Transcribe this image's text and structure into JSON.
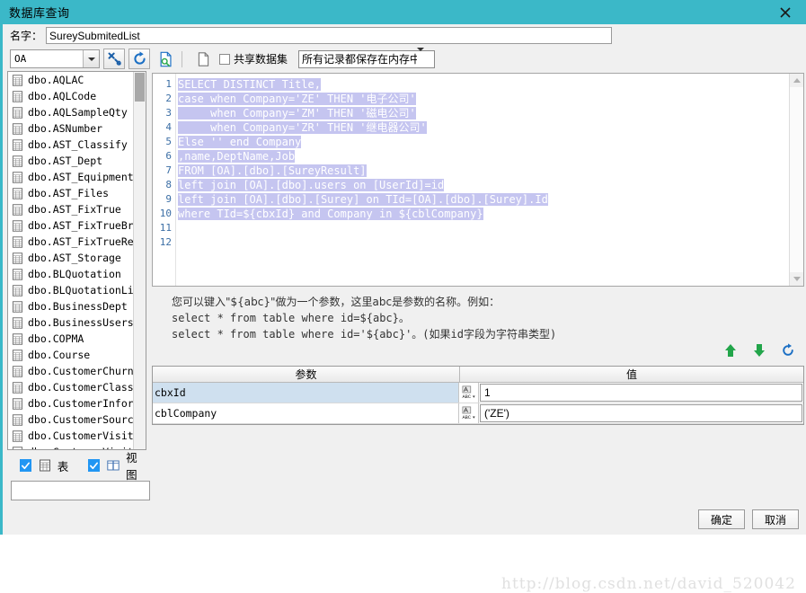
{
  "window": {
    "title": "数据库查询",
    "close_icon": "close-icon"
  },
  "name_row": {
    "label": "名字：",
    "value": "SureySubmitedList",
    "placeholder": ""
  },
  "toolbar": {
    "connection": "OA",
    "tools_icon": "wrench-tools-icon",
    "refresh_icon": "refresh-icon",
    "preview_icon": "preview-document-icon",
    "new_icon": "new-document-icon",
    "shared_dataset_label": "共享数据集",
    "shared_dataset_checked": false,
    "storage_mode": "所有记录都保存在内存中"
  },
  "sidebar": {
    "items": [
      "dbo.AQLAC",
      "dbo.AQLCode",
      "dbo.AQLSampleQty",
      "dbo.ASNumber",
      "dbo.AST_Classify",
      "dbo.AST_Dept",
      "dbo.AST_Equipment",
      "dbo.AST_Files",
      "dbo.AST_FixTrue",
      "dbo.AST_FixTrueBrorro",
      "dbo.AST_FixTrueReturn",
      "dbo.AST_Storage",
      "dbo.BLQuotation",
      "dbo.BLQuotationLine",
      "dbo.BusinessDept",
      "dbo.BusinessUsers",
      "dbo.COPMA",
      "dbo.Course",
      "dbo.CustomerChurn",
      "dbo.CustomerClass",
      "dbo.CustomerInformat",
      "dbo.CustomerSource",
      "dbo.CustomerVisitSug",
      "dbo.CustomerVisits"
    ],
    "table_checkbox": {
      "label": "表",
      "checked": true,
      "icon": "table-icon"
    },
    "view_checkbox": {
      "label": "视图",
      "checked": true,
      "icon": "view-icon"
    },
    "filter_value": "",
    "filter_placeholder": ""
  },
  "sql": {
    "lines": [
      {
        "no": "1",
        "text": "SELECT DISTINCT Title,"
      },
      {
        "no": "2",
        "text": "case when Company='ZE' THEN '电子公司'"
      },
      {
        "no": "3",
        "text": "     when Company='ZM' THEN '磁电公司'"
      },
      {
        "no": "4",
        "text": "     when Company='ZR' THEN '继电器公司'"
      },
      {
        "no": "5",
        "text": "Else '' end Company"
      },
      {
        "no": "6",
        "text": ",name,DeptName,Job"
      },
      {
        "no": "7",
        "text": "FROM [OA].[dbo].[SureyResult]"
      },
      {
        "no": "8",
        "text": "left join [OA].[dbo].users on [UserId]=id"
      },
      {
        "no": "9",
        "text": "left join [OA].[dbo].[Surey] on TId=[OA].[dbo].[Surey].Id"
      },
      {
        "no": "10",
        "text": "where TId=${cbxId} and Company in ${cblCompany}"
      },
      {
        "no": "11",
        "text": ""
      },
      {
        "no": "12",
        "text": ""
      }
    ],
    "selection_color": "#c5c5f0"
  },
  "hint": {
    "line1": "您可以键入\"${abc}\"做为一个参数，这里abc是参数的名称。例如：",
    "line2": "select * from table where id=${abc}。",
    "line3": "select * from table where id='${abc}'。(如果id字段为字符串类型)"
  },
  "nav_buttons": {
    "up_icon": "arrow-up-icon",
    "down_icon": "arrow-down-icon",
    "refresh_icon": "refresh-icon"
  },
  "params": {
    "headers": [
      "参数",
      "值"
    ],
    "rows": [
      {
        "name": "cbxId",
        "value": "1",
        "editor_icon": "abc-editor-icon",
        "selected": true
      },
      {
        "name": "cblCompany",
        "value": "('ZE')",
        "editor_icon": "abc-editor-icon",
        "selected": false
      }
    ]
  },
  "watermark": "http://blog.csdn.net/david_520042",
  "footer": {
    "ok_label": "确定",
    "cancel_label": "取消"
  },
  "colors": {
    "titlebar": "#3bb8c8",
    "accent_blue": "#2196f3",
    "arrow_green": "#22a54a",
    "selection": "#c5c5f0",
    "row_selected": "#cfe0ef"
  }
}
